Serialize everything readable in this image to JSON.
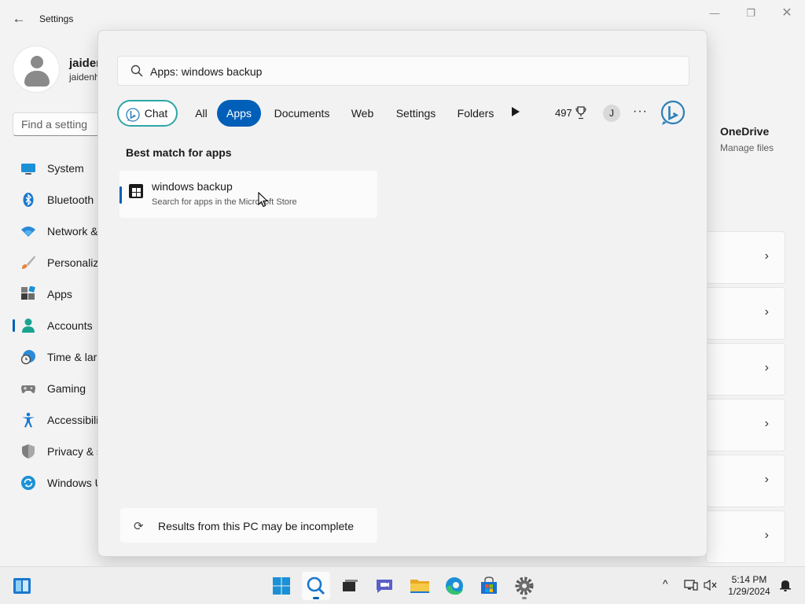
{
  "window": {
    "title": "Settings",
    "back_label": "←",
    "minimize_glyph": "—",
    "maximize_glyph": "❐",
    "close_glyph": "✕"
  },
  "profile": {
    "name": "jaiden",
    "email": "jaidenh"
  },
  "find_setting": {
    "placeholder": "Find a setting"
  },
  "nav": {
    "items": [
      {
        "label": "System",
        "icon": "monitor-icon"
      },
      {
        "label": "Bluetooth",
        "icon": "bluetooth-icon"
      },
      {
        "label": "Network &",
        "icon": "wifi-icon"
      },
      {
        "label": "Personaliza",
        "icon": "brush-icon"
      },
      {
        "label": "Apps",
        "icon": "apps-icon"
      },
      {
        "label": "Accounts",
        "icon": "person-icon"
      },
      {
        "label": "Time & lar",
        "icon": "clock-globe-icon"
      },
      {
        "label": "Gaming",
        "icon": "gamepad-icon"
      },
      {
        "label": "Accessibilit",
        "icon": "accessibility-icon"
      },
      {
        "label": "Privacy & s",
        "icon": "shield-icon"
      },
      {
        "label": "Windows U",
        "icon": "update-icon"
      }
    ],
    "active": "Accounts"
  },
  "onedrive": {
    "title": "OneDrive",
    "subtitle": "Manage files"
  },
  "search": {
    "query": "Apps: windows backup",
    "filters": {
      "chat": "Chat",
      "all": "All",
      "apps": "Apps",
      "documents": "Documents",
      "web": "Web",
      "settings": "Settings",
      "folders": "Folders"
    },
    "active_filter": "Apps",
    "points": "497",
    "avatar_initial": "J",
    "more_label": "···",
    "section_title": "Best match for apps",
    "result": {
      "title": "windows backup",
      "subtitle": "Search for apps in the Microsoft Store"
    },
    "footer": "Results from this PC may be incomplete",
    "sync_glyph": "⟳"
  },
  "taskbar": {
    "time": "5:14 PM",
    "date": "1/29/2024",
    "tray_arrow": "^"
  },
  "colors": {
    "accent": "#005fb8",
    "chat_border": "#2fa6a6"
  }
}
